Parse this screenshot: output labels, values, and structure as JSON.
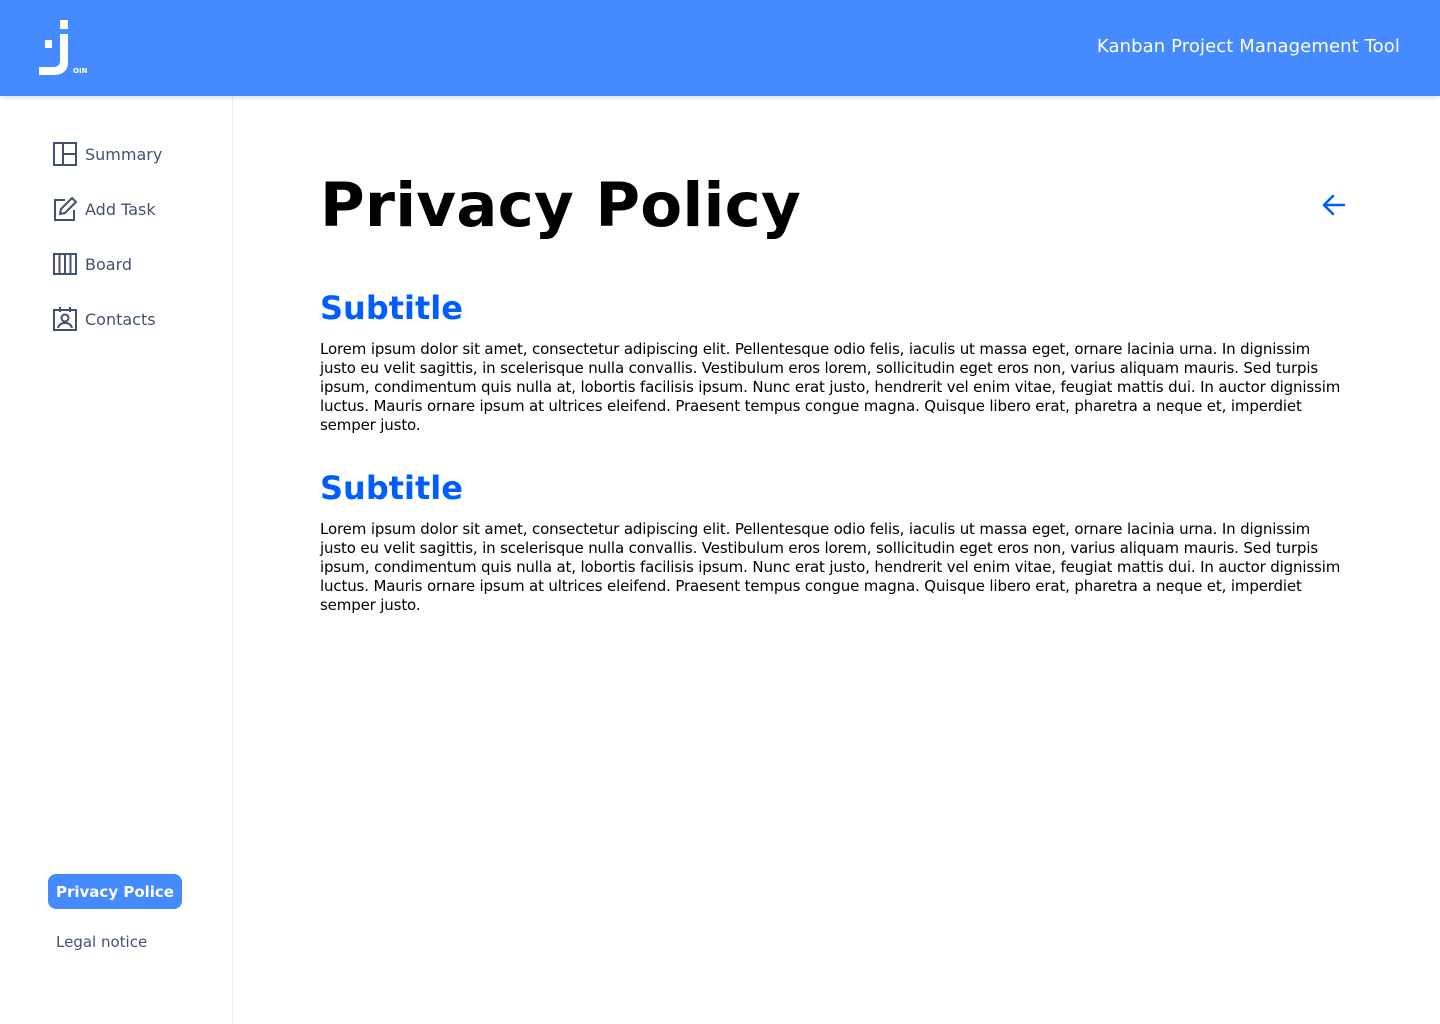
{
  "header": {
    "title": "Kanban Project Management Tool",
    "logo_icon": "join-logo-icon",
    "logo_text": "OIN",
    "background": "#458AFF"
  },
  "sidebar": {
    "items": [
      {
        "label": "Summary",
        "icon": "summary-icon"
      },
      {
        "label": "Add Task",
        "icon": "edit-icon"
      },
      {
        "label": "Board",
        "icon": "board-icon"
      },
      {
        "label": "Contacts",
        "icon": "contacts-icon"
      }
    ],
    "privacy_label": "Privacy Police",
    "legal_label": "Legal notice"
  },
  "main": {
    "title": "Privacy Policy",
    "back_icon": "arrow-left-icon",
    "sections": [
      {
        "subtitle": "Subtitle",
        "text": "Lorem ipsum dolor sit amet, consectetur adipiscing elit. Pellentesque odio felis, iaculis ut massa eget, ornare lacinia urna. In dignissim justo eu velit sagittis, in scelerisque nulla convallis. Vestibulum eros lorem, sollicitudin eget eros non, varius aliquam mauris. Sed turpis ipsum, condimentum quis nulla at, lobortis facilisis ipsum. Nunc erat justo, hendrerit vel enim vitae, feugiat mattis dui. In auctor dignissim luctus. Mauris ornare ipsum at ultrices eleifend. Praesent tempus congue magna. Quisque libero erat, pharetra a neque et, imperdiet semper justo."
      },
      {
        "subtitle": "Subtitle",
        "text": "Lorem ipsum dolor sit amet, consectetur adipiscing elit. Pellentesque odio felis, iaculis ut massa eget, ornare lacinia urna. In dignissim justo eu velit sagittis, in scelerisque nulla convallis. Vestibulum eros lorem, sollicitudin eget eros non, varius aliquam mauris. Sed turpis ipsum, condimentum quis nulla at, lobortis facilisis ipsum. Nunc erat justo, hendrerit vel enim vitae, feugiat mattis dui. In auctor dignissim luctus. Mauris ornare ipsum at ultrices eleifend. Praesent tempus congue magna. Quisque libero erat, pharetra a neque et, imperdiet semper justo."
      }
    ]
  },
  "colors": {
    "accent": "#458AFF",
    "subtitle": "#005DFF",
    "nav_text": "#42526E"
  }
}
